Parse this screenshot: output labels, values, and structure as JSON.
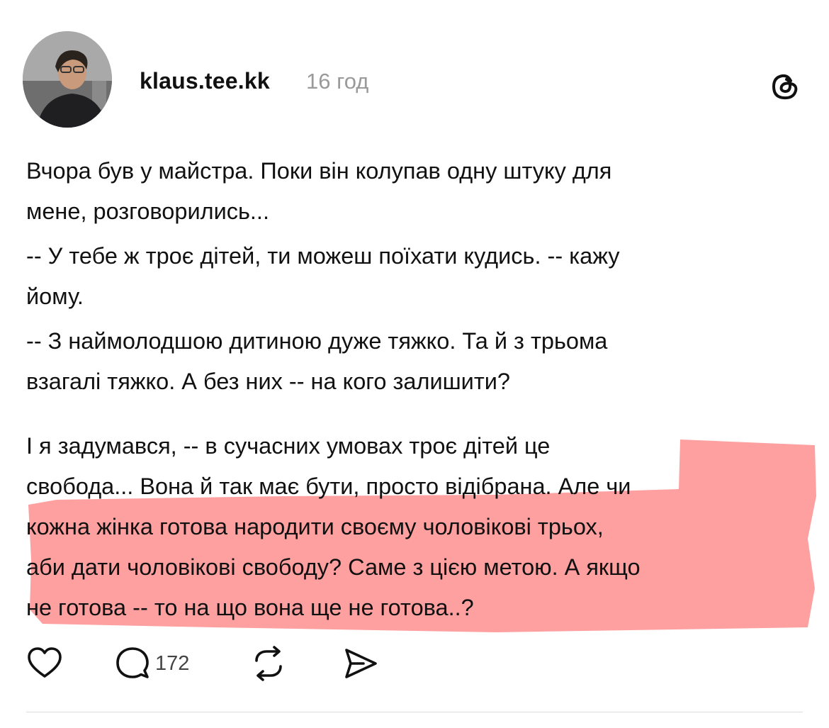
{
  "post": {
    "username": "klaus.tee.kk",
    "time_ago": "16 год",
    "paragraphs": [
      "Вчора був у майстра. Поки він колупав одну штуку для\nмене, розговорились...",
      "-- У тебе ж троє дітей, ти можеш поїхати кудись. -- кажу\nйому.",
      "-- З наймолодшою дитиною дуже тяжко. Та й з трьома\nвзагалі тяжко. А без них -- на кого залишити?",
      "І я задумався, -- в сучасних умовах троє дітей це\nсвобода... Вона й так має бути, просто відібрана. Але чи\nкожна жінка готова народити своєму чоловікові трьох,\nаби дати чоловікові свободу? Саме з цією метою. А якщо\nне готова -- то на що вона ще не готова..?"
    ],
    "highlight_color": "#ff8f8f"
  },
  "actions": {
    "like_icon": "heart-icon",
    "reply_icon": "comment-bubble-icon",
    "reply_count": "172",
    "repost_icon": "repost-icon",
    "share_icon": "send-icon"
  },
  "header": {
    "logo_icon": "threads-logo-icon"
  }
}
